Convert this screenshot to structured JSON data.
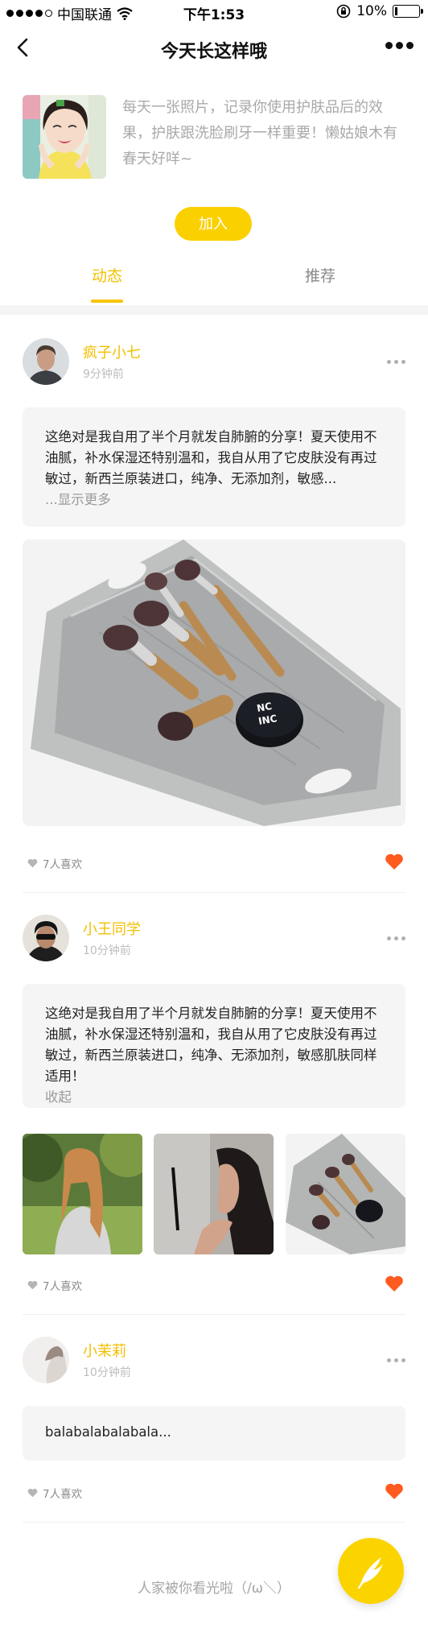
{
  "status_bar": {
    "carrier": "中国联通",
    "time": "下午1:53",
    "battery": "10%"
  },
  "nav": {
    "title": "今天长这样哦"
  },
  "header": {
    "description": "每天一张照片，记录你使用护肤品后的效果，护肤跟洗脸刷牙一样重要！懒姑娘木有春天好咩~",
    "join_label": "加入"
  },
  "tabs": [
    {
      "label": "动态",
      "active": true
    },
    {
      "label": "推荐",
      "active": false
    }
  ],
  "posts": [
    {
      "user": "疯子小七",
      "time": "9分钟前",
      "text": "这绝对是我自用了半个月就发自肺腑的分享！夏天使用不油腻，补水保湿还特别温和，我自从用了它皮肤没有再过敏过，新西兰原装进口，纯净、无添加剂，敏感...",
      "toggle": "...显示更多",
      "likes": "7人喜欢",
      "jar_label_1": "NC",
      "jar_label_2": "INC"
    },
    {
      "user": "小王同学",
      "time": "10分钟前",
      "text": "这绝对是我自用了半个月就发自肺腑的分享！夏天使用不油腻，补水保湿还特别温和，我自从用了它皮肤没有再过敏过，新西兰原装进口，纯净、无添加剂，敏感肌肤同样适用！",
      "toggle": "收起",
      "likes": "7人喜欢"
    },
    {
      "user": "小茉莉",
      "time": "10分钟前",
      "text": "balabalabalabala...",
      "likes": "7人喜欢"
    }
  ],
  "footer": {
    "text": "人家被你看光啦（/ω＼）"
  },
  "colors": {
    "accent": "#fbd000",
    "heart": "#ff5a1f",
    "muted": "#a9a9a9"
  },
  "icons": [
    "signal-icon",
    "wifi-icon",
    "lock-rotation-icon",
    "battery-icon",
    "back-icon",
    "more-icon",
    "heart-icon",
    "feather-icon"
  ]
}
